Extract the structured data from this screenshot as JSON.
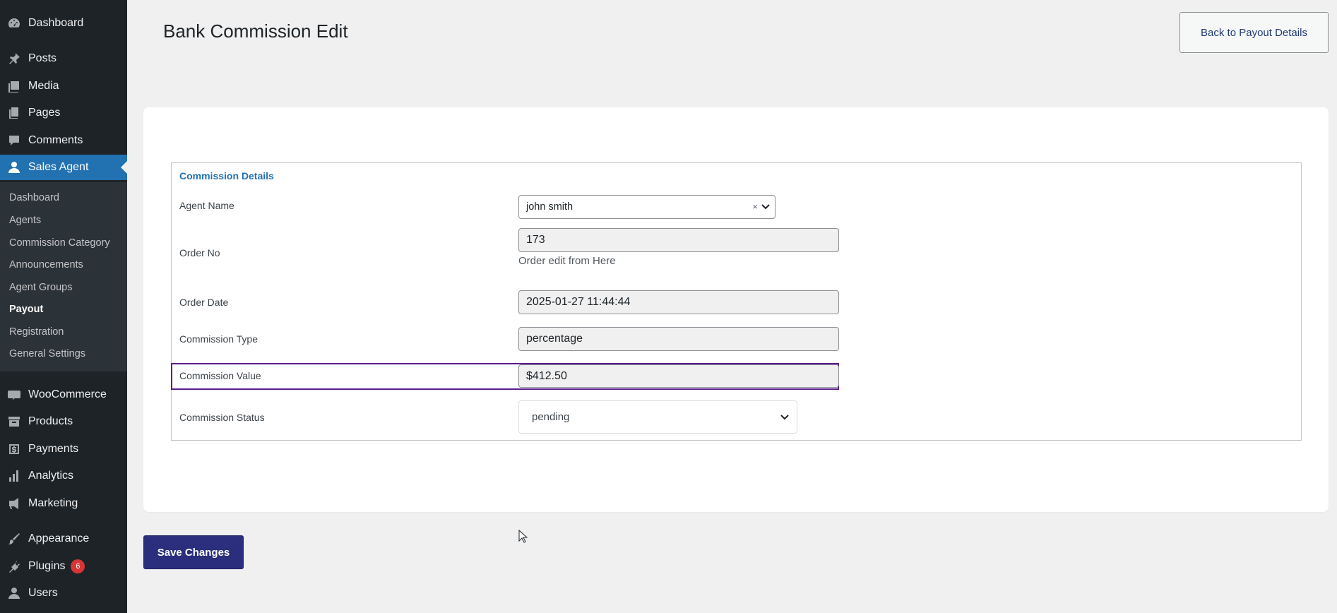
{
  "sidebar": {
    "items": [
      {
        "label": "Dashboard",
        "icon": "dashboard-icon"
      },
      {
        "label": "Posts",
        "icon": "pin-icon"
      },
      {
        "label": "Media",
        "icon": "media-icon"
      },
      {
        "label": "Pages",
        "icon": "pages-icon"
      },
      {
        "label": "Comments",
        "icon": "comment-icon"
      },
      {
        "label": "Sales Agent",
        "icon": "user-icon"
      },
      {
        "label": "WooCommerce",
        "icon": "woo-icon"
      },
      {
        "label": "Products",
        "icon": "archive-icon"
      },
      {
        "label": "Payments",
        "icon": "dollar-icon"
      },
      {
        "label": "Analytics",
        "icon": "bar-chart-icon"
      },
      {
        "label": "Marketing",
        "icon": "megaphone-icon"
      },
      {
        "label": "Appearance",
        "icon": "brush-icon"
      },
      {
        "label": "Plugins",
        "icon": "plug-icon",
        "badge": "6"
      },
      {
        "label": "Users",
        "icon": "user-icon"
      }
    ],
    "submenu": [
      "Dashboard",
      "Agents",
      "Commission Category",
      "Announcements",
      "Agent Groups",
      "Payout",
      "Registration",
      "General Settings"
    ],
    "active_color": "#2271b1"
  },
  "header": {
    "title": "Bank Commission Edit",
    "back_label": "Back to Payout Details"
  },
  "form": {
    "legend": "Commission Details",
    "agent_label": "Agent Name",
    "agent_value": "john smith",
    "clear_symbol": "×",
    "order_no_label": "Order No",
    "order_no_value": "173",
    "order_hint": "Order edit from Here",
    "order_date_label": "Order Date",
    "order_date_value": "2025-01-27 11:44:44",
    "type_label": "Commission Type",
    "type_value": "percentage",
    "value_label": "Commission Value",
    "value_value": "$412.50",
    "status_label": "Commission Status",
    "status_value": "pending"
  },
  "footer": {
    "save_label": "Save Changes",
    "save_color": "#2b2e7d"
  }
}
